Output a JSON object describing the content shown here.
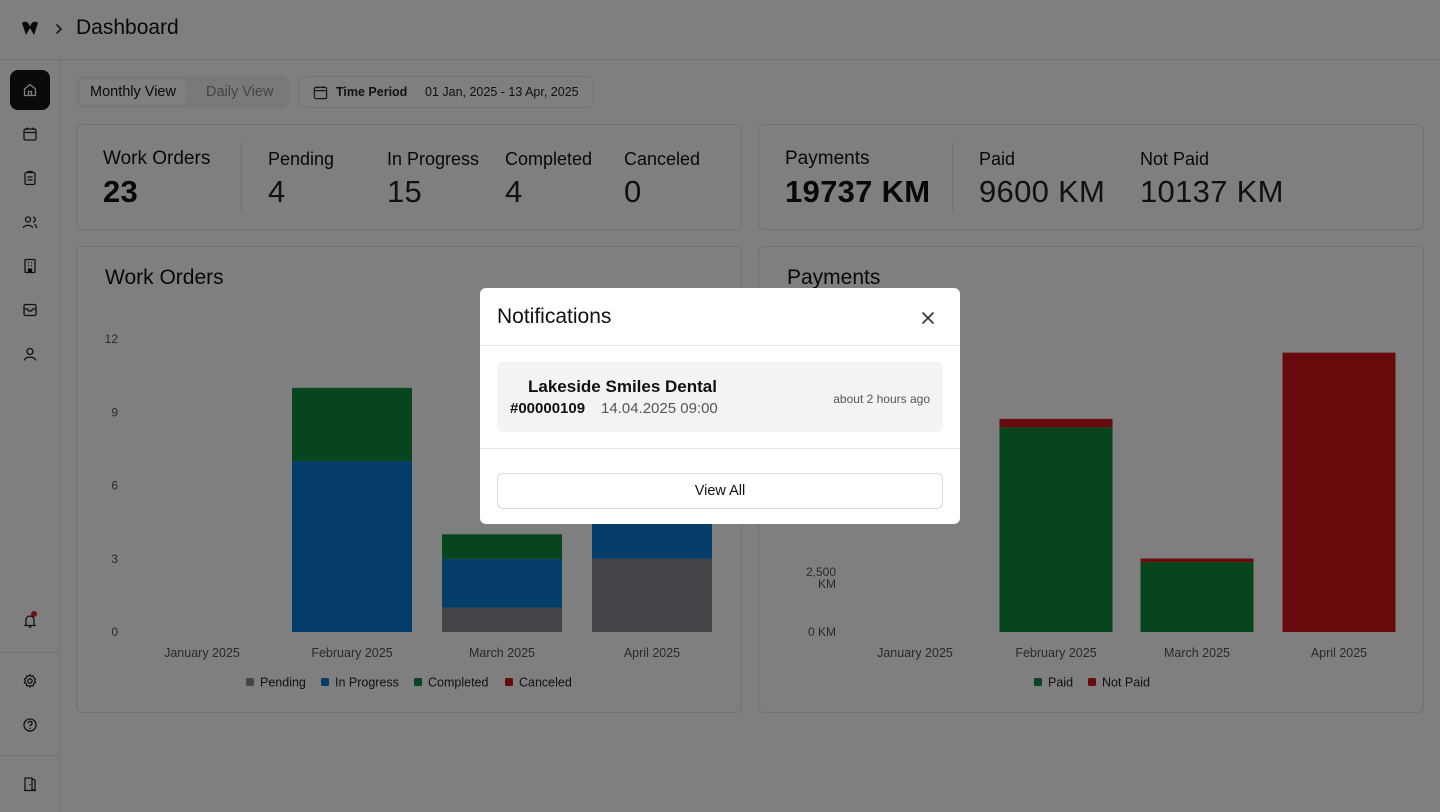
{
  "header": {
    "title": "Dashboard"
  },
  "controls": {
    "views": [
      "Monthly View",
      "Daily View"
    ],
    "active_view": "Monthly View",
    "time_period_label": "Time Period",
    "time_period_value": "01 Jan, 2025 - 13 Apr, 2025"
  },
  "work_orders_summary": {
    "title": "Work Orders",
    "total": "23",
    "stats": [
      {
        "label": "Pending",
        "value": "4"
      },
      {
        "label": "In Progress",
        "value": "15"
      },
      {
        "label": "Completed",
        "value": "4"
      },
      {
        "label": "Canceled",
        "value": "0"
      }
    ]
  },
  "payments_summary": {
    "title": "Payments",
    "total": "19737 KM",
    "stats": [
      {
        "label": "Paid",
        "value": "9600 KM"
      },
      {
        "label": "Not Paid",
        "value": "10137 KM"
      }
    ]
  },
  "colors": {
    "pending": "#898b92",
    "in_progress": "#0a7fd2",
    "completed": "#0d8a3a",
    "canceled": "#d01416",
    "paid": "#0d8a3a",
    "not_paid": "#d01416"
  },
  "chart_data": [
    {
      "type": "bar",
      "stacked": true,
      "title": "Work Orders",
      "categories": [
        "January 2025",
        "February 2025",
        "March 2025",
        "April 2025"
      ],
      "yticks": [
        "0",
        "3",
        "6",
        "9",
        "12"
      ],
      "ylim": [
        0,
        12
      ],
      "series": [
        {
          "name": "Pending",
          "values": [
            0,
            0,
            1,
            3
          ]
        },
        {
          "name": "In Progress",
          "values": [
            0,
            7,
            2,
            6
          ]
        },
        {
          "name": "Completed",
          "values": [
            0,
            3,
            1,
            0
          ]
        },
        {
          "name": "Canceled",
          "values": [
            0,
            0,
            0,
            0
          ]
        }
      ],
      "legend": "bottom"
    },
    {
      "type": "bar",
      "stacked": true,
      "title": "Payments",
      "categories": [
        "January 2025",
        "February 2025",
        "March 2025",
        "April 2025"
      ],
      "yticks": [
        "0 KM",
        "2,500 KM"
      ],
      "ylim": [
        0,
        12000
      ],
      "series": [
        {
          "name": "Paid",
          "values": [
            0,
            8500,
            2900,
            0
          ]
        },
        {
          "name": "Not Paid",
          "values": [
            0,
            350,
            150,
            11600
          ]
        }
      ],
      "legend": "bottom"
    }
  ],
  "notifications": {
    "title": "Notifications",
    "items": [
      {
        "name": "Lakeside Smiles Dental",
        "order_id": "#00000109",
        "datetime": "14.04.2025 09:00",
        "time_ago": "about 2 hours ago"
      }
    ],
    "view_all_label": "View All"
  },
  "sidebar": {
    "icons": [
      "home-icon",
      "calendar-icon",
      "clipboard-icon",
      "users-icon",
      "building-icon",
      "inbox-icon",
      "user-icon",
      "bell-icon",
      "gear-icon",
      "help-icon",
      "logout-icon"
    ]
  }
}
